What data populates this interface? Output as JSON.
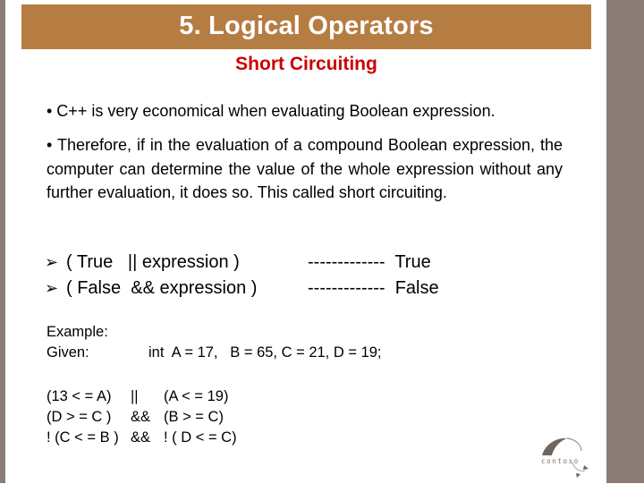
{
  "slide": {
    "title": "5. Logical Operators",
    "subtitle": "Short Circuiting",
    "colors": {
      "title_bar": "#b67d42",
      "title_text": "#ffffff",
      "subtitle": "#cc0000",
      "side_strips": "#8b7d76",
      "body_text": "#000000"
    }
  },
  "bullets": [
    {
      "icon": "bullet-dot",
      "text": "• C++ is very economical when evaluating Boolean expression."
    },
    {
      "icon": "bullet-dot",
      "text": "• Therefore, if in the evaluation of a compound Boolean expression, the computer can determine the value of the whole expression without any further evaluation, it does so. This called short circuiting."
    }
  ],
  "rules": [
    {
      "icon": "arrow-bullet",
      "glyph": "➢",
      "expression": "( True   || expression )",
      "result": "-------------  True"
    },
    {
      "icon": "arrow-bullet",
      "glyph": "➢",
      "expression": "( False  && expression )",
      "result": "-------------  False"
    }
  ],
  "example": {
    "label": "Example:",
    "given_label": "Given:",
    "given_code": "int  A = 17,   B = 65, C = 21, D = 19;",
    "expressions": [
      {
        "left": "(13 < = A)",
        "op": "||",
        "right": "(A < = 19)"
      },
      {
        "left": "(D > = C )",
        "op": "&&",
        "right": "(B > = C)"
      },
      {
        "left": "! (C < = B )",
        "op": "&&",
        "right": "! ( D < = C)"
      }
    ]
  },
  "logo": {
    "text": "contoso",
    "icon": "contoso-swoosh-logo"
  }
}
